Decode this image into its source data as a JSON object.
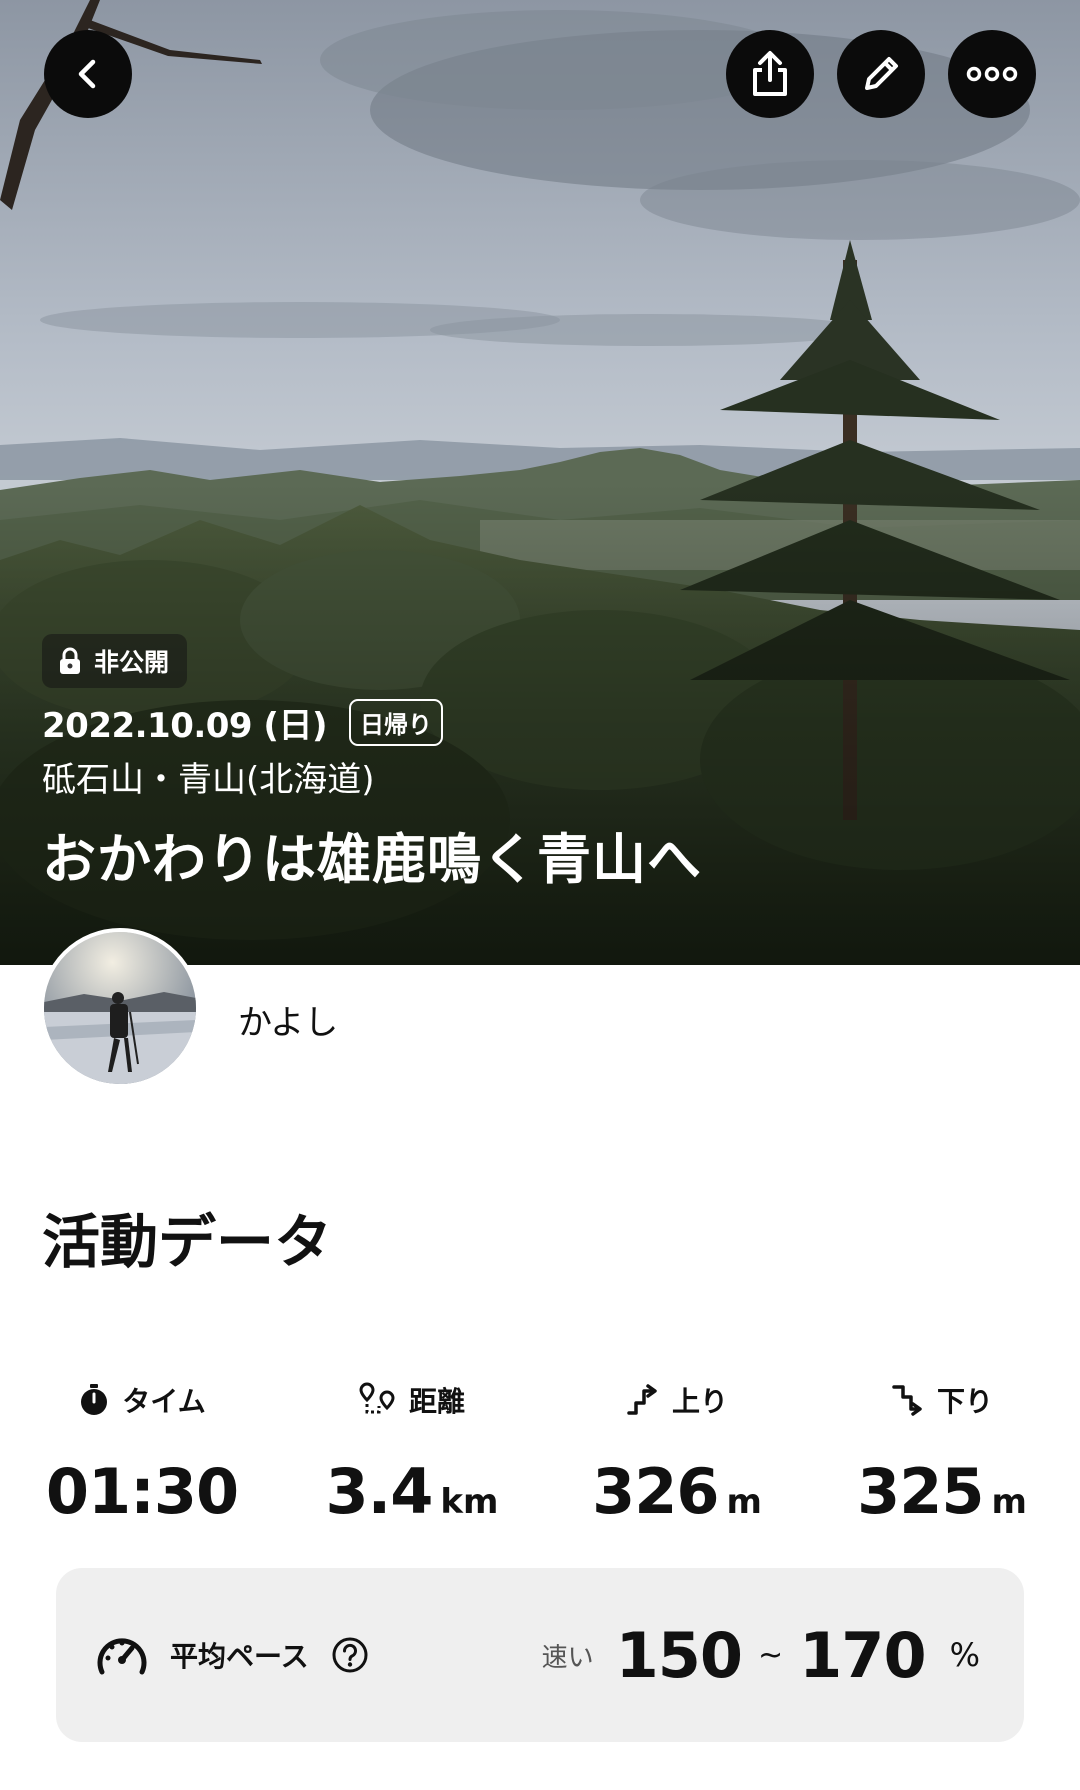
{
  "hero": {
    "privacy_label": "非公開",
    "date": "2022.10.09 (日)",
    "trip_type": "日帰り",
    "mountains": "砥石山・青山(北海道)",
    "title": "おかわりは雄鹿鳴く青山へ"
  },
  "toolbar": {
    "back_icon": "chevron-left-icon",
    "share_icon": "share-icon",
    "edit_icon": "pencil-icon",
    "more_icon": "more-dots-icon"
  },
  "user": {
    "name": "かよし"
  },
  "activity": {
    "section_title": "活動データ",
    "stats": [
      {
        "label": "タイム",
        "icon": "stopwatch-icon",
        "value": "01:30",
        "unit": ""
      },
      {
        "label": "距離",
        "icon": "route-icon",
        "value": "3.4",
        "unit": "km"
      },
      {
        "label": "上り",
        "icon": "ascent-icon",
        "value": "326",
        "unit": "m"
      },
      {
        "label": "下り",
        "icon": "descent-icon",
        "value": "325",
        "unit": "m"
      }
    ],
    "pace": {
      "label": "平均ペース",
      "icon": "speedometer-icon",
      "help_icon": "question-icon",
      "speed_label": "速い",
      "min": "150",
      "separator": "~",
      "max": "170",
      "unit": "%"
    }
  }
}
